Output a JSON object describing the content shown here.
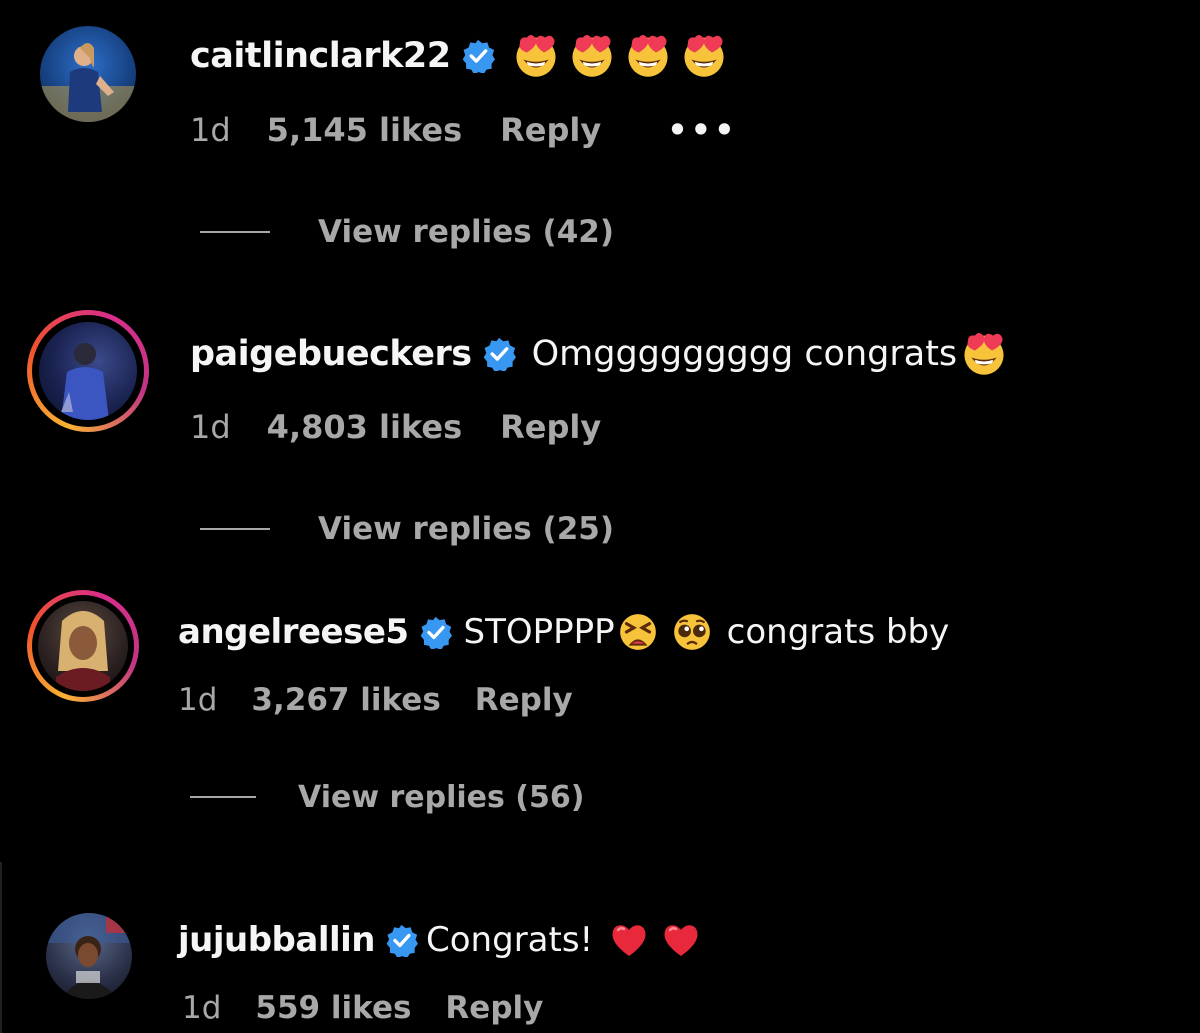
{
  "comments": [
    {
      "username": "caitlinclark22",
      "text": "",
      "emoji": [
        "heart-eyes",
        "heart-eyes",
        "heart-eyes",
        "heart-eyes"
      ],
      "time": "1d",
      "likes": "5,145 likes",
      "reply": "Reply",
      "more": "•••",
      "view_replies": "View replies (42)"
    },
    {
      "username": "paigebueckers",
      "text": "Omggggggggg congrats",
      "emoji": [
        "heart-eyes"
      ],
      "time": "1d",
      "likes": "4,803 likes",
      "reply": "Reply",
      "view_replies": "View replies (25)"
    },
    {
      "username": "angelreese5",
      "text": "STOPPPP",
      "text2": "congrats bby",
      "emoji": [
        "tired-face",
        "pleading-face"
      ],
      "time": "1d",
      "likes": "3,267 likes",
      "reply": "Reply",
      "view_replies": "View replies (56)"
    },
    {
      "username": "jujubballin",
      "text": "Congrats!",
      "emoji": [
        "red-heart",
        "red-heart"
      ],
      "time": "1d",
      "likes": "559 likes",
      "reply": "Reply"
    }
  ],
  "colors": {
    "background": "#000000",
    "text": "#f5f5f5",
    "muted": "#a8a8a8",
    "verified": "#3897f0",
    "story_ring": [
      "#f9b233",
      "#f0532b",
      "#d92e8b"
    ]
  }
}
